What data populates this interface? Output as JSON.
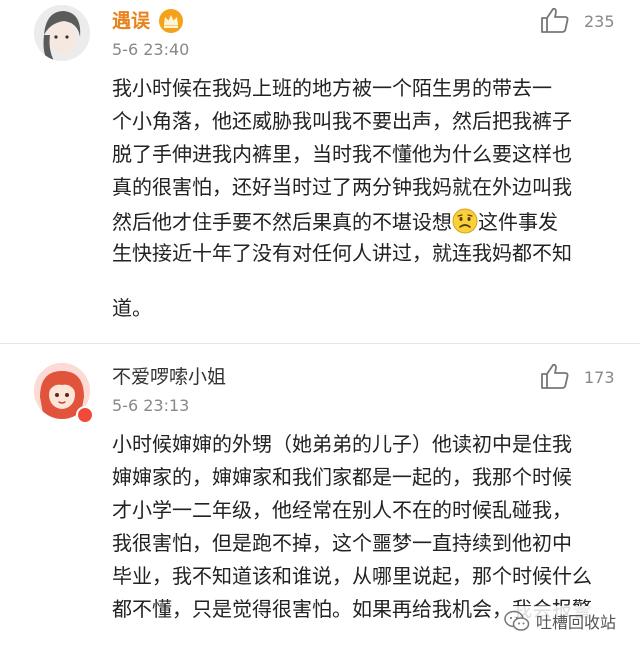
{
  "comments": [
    {
      "username": "遇误",
      "time": "5-6 23:40",
      "likes": "235",
      "lines": [
        "我小时候在我妈上班的地方被一个陌生男的带去一",
        "个小角落，他还威胁我叫我不要出声，然后把我裤子",
        "脱了手伸进我内裤里，当时我不懂他为什么要这样也",
        "真的很害怕，还好当时过了两分钟我妈就在外边叫我",
        "然后他才住手要不然后果真的不堪设想",
        "这件事发",
        "生快接近十年了没有对任何人讲过，就连我妈都不知",
        "道。"
      ],
      "emoji": "sad-face-emoji"
    },
    {
      "username": "不爱啰嗦小姐",
      "time": "5-6 23:13",
      "likes": "173",
      "lines": [
        "小时候婶婶的外甥（她弟弟的儿子）他读初中是住我",
        "婶婶家的，婶婶家和我们家都是一起的，我那个时候",
        "才小学一二年级，他经常在别人不在的时候乱碰我，",
        "我很害怕，但是跑不掉，这个噩梦一直持续到他初中",
        "毕业，我不知道该和谁说，从哪里说起，那个时候什么",
        "都不懂，只是觉得很害怕。如果再给我机会，我会报警"
      ]
    }
  ],
  "watermark": {
    "text": "吐槽回收站"
  },
  "colors": {
    "username_vip": "#e8821a",
    "muted": "#888888",
    "text": "#222222"
  }
}
